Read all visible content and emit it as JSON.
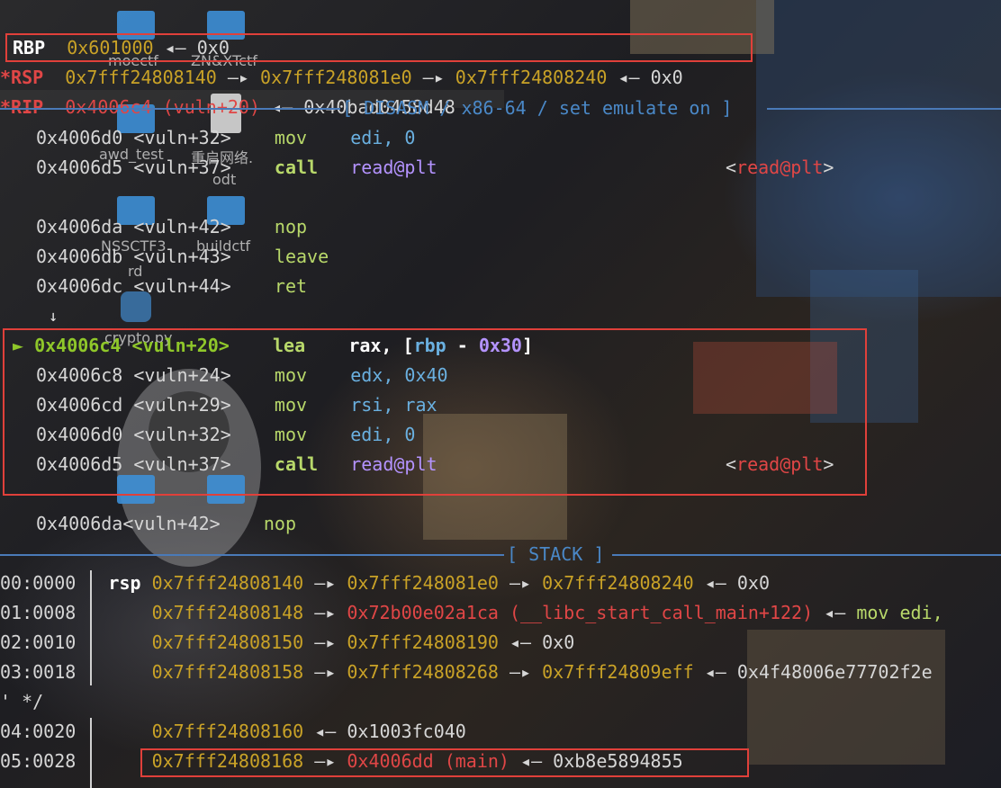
{
  "registers": {
    "rbp": {
      "name": "RBP",
      "value": "0x601000",
      "arrow": "◂—",
      "target": "0x0"
    },
    "rsp": {
      "name": "*RSP",
      "v1": "0x7fff24808140",
      "a1": "—▸",
      "v2": "0x7fff248081e0",
      "a2": "—▸",
      "v3": "0x7fff24808240",
      "a3": "◂—",
      "v4": "0x0"
    },
    "rip": {
      "name": "*RIP",
      "value": "0x4006c4 (vuln+20)",
      "arrow": "◂—",
      "target": "0x40bad0458d48"
    }
  },
  "disasm_header": "[ DISASM / x86-64 / set emulate on ]",
  "disasm": [
    {
      "addr": "0x4006d0 <vuln+32>",
      "mn": "mov",
      "op": "edi, 0"
    },
    {
      "addr": "0x4006d5 <vuln+37>",
      "mn": "call",
      "op": "read@plt",
      "tgt_l": "<",
      "tgt": "read@plt",
      "tgt_r": ">"
    },
    {
      "addr": "0x4006da <vuln+42>",
      "mn": "nop",
      "op": ""
    },
    {
      "addr": "0x4006db <vuln+43>",
      "mn": "leave",
      "op": ""
    },
    {
      "addr": "0x4006dc <vuln+44>",
      "mn": "ret",
      "op": ""
    },
    {
      "marker": "↓"
    },
    {
      "cur": "►",
      "addr": "0x4006c4 <vuln+20>",
      "mn": "lea",
      "op_a": "rax, [",
      "op_b": "rbp",
      "op_c": " - ",
      "op_d": "0x30",
      "op_e": "]"
    },
    {
      "addr": "0x4006c8 <vuln+24>",
      "mn": "mov",
      "op": "edx, 0x40"
    },
    {
      "addr": "0x4006cd <vuln+29>",
      "mn": "mov",
      "op": "rsi, rax"
    },
    {
      "addr": "0x4006d0 <vuln+32>",
      "mn": "mov",
      "op": "edi, 0"
    },
    {
      "addr": "0x4006d5 <vuln+37>",
      "mn": "call",
      "op": "read@plt",
      "tgt_l": "<",
      "tgt": "read@plt",
      "tgt_r": ">"
    },
    {
      "addr": "0x4006da<vuln+42>",
      "mn": "nop",
      "op": ""
    }
  ],
  "stack_header": "[ STACK ]",
  "stack": [
    {
      "off": "00:0000",
      "reg": "rsp",
      "a": "0x7fff24808140",
      "ar1": "—▸",
      "b": "0x7fff248081e0",
      "ar2": "—▸",
      "c": "0x7fff24808240",
      "ar3": "◂—",
      "d": "0x0"
    },
    {
      "off": "01:0008",
      "a": "0x7fff24808148",
      "ar1": "—▸",
      "b": "0x72b00e02a1ca (__libc_start_call_main+122)",
      "ar2": "◂—",
      "c": "mov edi,"
    },
    {
      "off": "02:0010",
      "a": "0x7fff24808150",
      "ar1": "—▸",
      "b": "0x7fff24808190",
      "ar2": "◂—",
      "c": "0x0"
    },
    {
      "off": "03:0018",
      "a": "0x7fff24808158",
      "ar1": "—▸",
      "b": "0x7fff24808268",
      "ar2": "—▸",
      "c": "0x7fff24809eff",
      "ar3": "◂—",
      "d": "0x4f48006e77702f2e"
    },
    {
      "wrap": "' */"
    },
    {
      "off": "04:0020",
      "a": "0x7fff24808160",
      "ar1": "◂—",
      "b": "0x1003fc040"
    },
    {
      "off": "05:0028",
      "a": "0x7fff24808168",
      "ar1": "—▸",
      "b": "0x4006dd (main)",
      "ar2": "◂—",
      "c": "0xb8e5894855"
    }
  ],
  "desktop_icons": [
    {
      "label": "moectf",
      "icon": "folder-icon"
    },
    {
      "label": "ZN&XTctf",
      "icon": "folder-icon"
    },
    {
      "label": "awd_test",
      "icon": "folder-icon"
    },
    {
      "label": "重启网络.",
      "icon": "document-icon"
    },
    {
      "label": "odt",
      "icon": "document-icon"
    },
    {
      "label": "NSSCTF3",
      "icon": "folder-icon"
    },
    {
      "label": "buildctf",
      "icon": "folder-icon"
    },
    {
      "label": "rd",
      "icon": "folder-icon"
    },
    {
      "label": "crypto.py",
      "icon": "python-icon"
    }
  ],
  "colors": {
    "highlight_box": "#e0403a",
    "separator": "#4a7ab8",
    "address": "#c9a227",
    "pointer_red": "#e04646",
    "mnemonic_call": "#b8d86a"
  }
}
